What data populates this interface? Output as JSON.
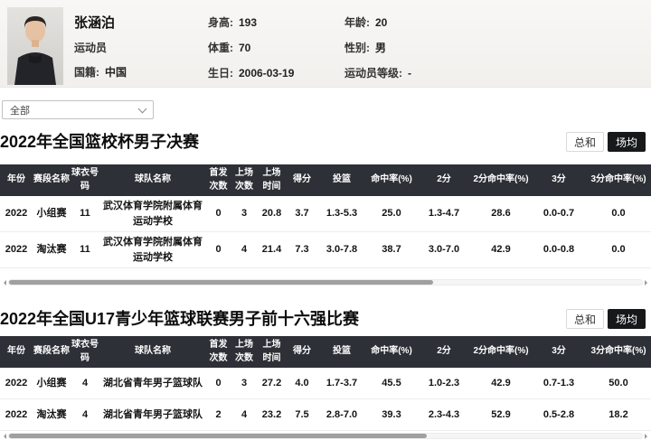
{
  "colors": {
    "table_header_bg": "#2d3036",
    "selected_toggle_bg": "#17181a",
    "panel_bg": "#f5f4f1"
  },
  "profile": {
    "name": "张涵泊",
    "role": "运动员",
    "nationality_label": "国籍:",
    "nationality_value": "中国",
    "col2": [
      {
        "label": "身高:",
        "value": "193"
      },
      {
        "label": "体重:",
        "value": "70"
      },
      {
        "label": "生日:",
        "value": "2006-03-19"
      }
    ],
    "col3": [
      {
        "label": "年龄:",
        "value": "20"
      },
      {
        "label": "性别:",
        "value": "男"
      },
      {
        "label": "运动员等级:",
        "value": "-"
      }
    ]
  },
  "filter": {
    "selected": "全部"
  },
  "sections": [
    {
      "title": "2022年全国篮校杯男子决赛",
      "toggle": {
        "sum": "总和",
        "avg": "场均"
      },
      "columns": [
        "年份",
        "赛段名称",
        "球衣号码",
        "球队名称",
        "首发次数",
        "上场次数",
        "上场时间",
        "得分",
        "投篮",
        "命中率(%)",
        "2分",
        "2分命中率(%)",
        "3分",
        "3分命中率(%)"
      ],
      "rows": [
        [
          "2022",
          "小组赛",
          "11",
          "武汉体育学院附属体育运动学校",
          "0",
          "3",
          "20.8",
          "3.7",
          "1.3-5.3",
          "25.0",
          "1.3-4.7",
          "28.6",
          "0.0-0.7",
          "0.0"
        ],
        [
          "2022",
          "淘汰赛",
          "11",
          "武汉体育学院附属体育运动学校",
          "0",
          "4",
          "21.4",
          "7.3",
          "3.0-7.8",
          "38.7",
          "3.0-7.0",
          "42.9",
          "0.0-0.8",
          "0.0"
        ]
      ]
    },
    {
      "title": "2022年全国U17青少年篮球联赛男子前十六强比赛",
      "toggle": {
        "sum": "总和",
        "avg": "场均"
      },
      "columns": [
        "年份",
        "赛段名称",
        "球衣号码",
        "球队名称",
        "首发次数",
        "上场次数",
        "上场时间",
        "得分",
        "投篮",
        "命中率(%)",
        "2分",
        "2分命中率(%)",
        "3分",
        "3分命中率(%)"
      ],
      "rows": [
        [
          "2022",
          "小组赛",
          "4",
          "湖北省青年男子篮球队",
          "0",
          "3",
          "27.2",
          "4.0",
          "1.7-3.7",
          "45.5",
          "1.0-2.3",
          "42.9",
          "0.7-1.3",
          "50.0"
        ],
        [
          "2022",
          "淘汰赛",
          "4",
          "湖北省青年男子篮球队",
          "2",
          "4",
          "23.2",
          "7.5",
          "2.8-7.0",
          "39.3",
          "2.3-4.3",
          "52.9",
          "0.5-2.8",
          "18.2"
        ]
      ]
    }
  ]
}
